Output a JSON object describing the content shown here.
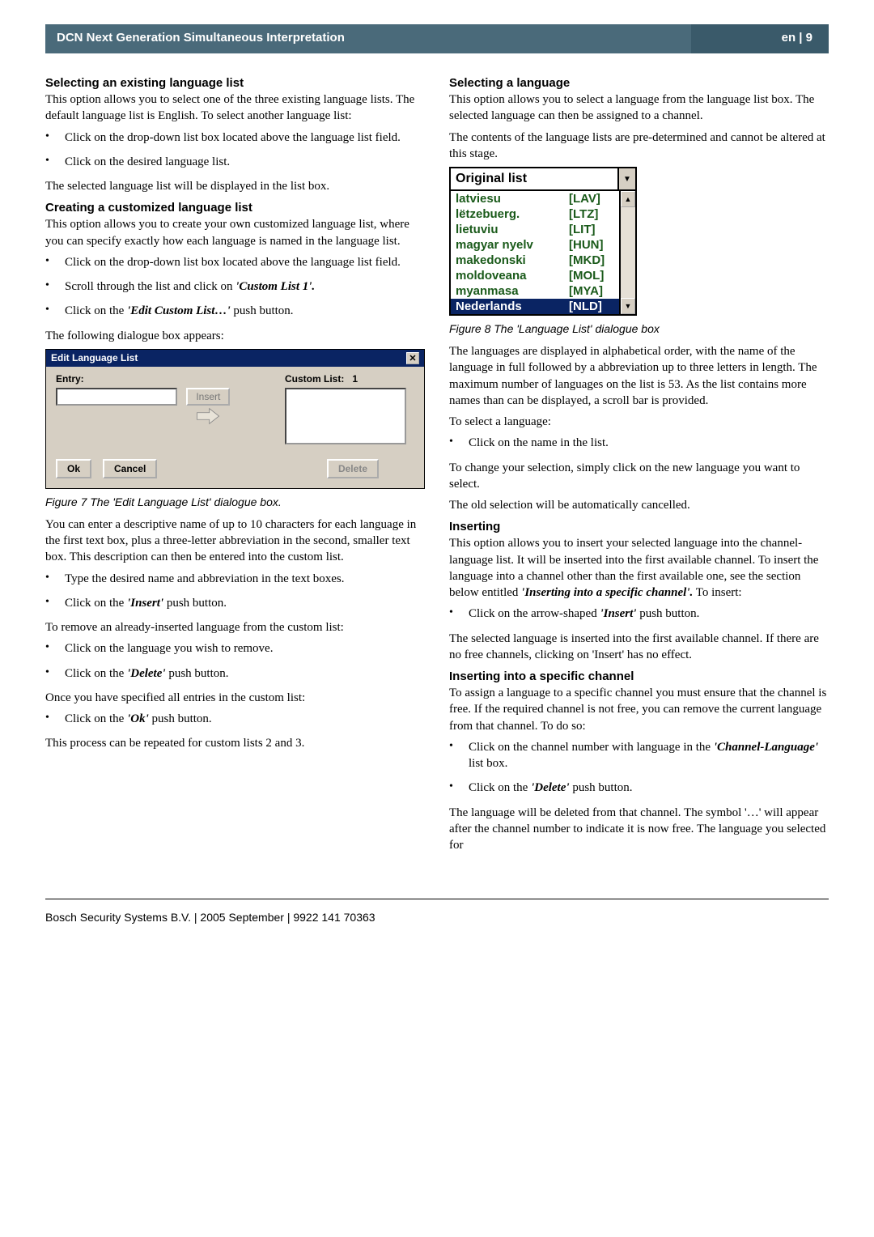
{
  "header": {
    "title": "DCN Next Generation Simultaneous Interpretation",
    "page": "en | 9"
  },
  "left": {
    "h1": "Selecting an existing language list",
    "p1": "This option allows you to select one of the three existing language lists. The default language list is English. To select another language list:",
    "b1": "Click on the drop-down list box located above the language list field.",
    "b2": "Click on the desired language list.",
    "p2": "The selected language list will be displayed in the list box.",
    "h2": "Creating a customized language list",
    "p3": "This option allows you to create your own customized language list, where you can specify exactly how each language is named in the language list.",
    "b3": "Click on the drop-down list box located above the language list field.",
    "b4a": "Scroll through the list and click on ",
    "b4b": "'Custom List 1'.",
    "b5a": "Click on the ",
    "b5b": "'Edit Custom List…'",
    "b5c": " push button.",
    "p4": "The following dialogue box appears:",
    "dlg": {
      "title": "Edit Language List",
      "entry": "Entry:",
      "insert": "Insert",
      "customlist": "Custom List:",
      "customnum": "1",
      "ok": "Ok",
      "cancel": "Cancel",
      "delete": "Delete"
    },
    "fig7": "Figure 7 The 'Edit Language List' dialogue box.",
    "p5": "You can enter a descriptive name of up to 10 characters for each language in the first text box, plus a three-letter abbreviation in the second, smaller text box. This description can then be entered into the custom list.",
    "b6": "Type the desired name and abbreviation in the text boxes.",
    "b7a": "Click on the ",
    "b7b": "'Insert'",
    "b7c": " push button.",
    "p6": "To remove an already-inserted language from the custom list:",
    "b8": "Click on the language you wish to remove.",
    "b9a": "Click on the ",
    "b9b": "'Delete'",
    "b9c": " push button.",
    "p7": "Once you have specified all entries in the custom list:",
    "b10a": "Click on the ",
    "b10b": "'Ok'",
    "b10c": " push button.",
    "p8": "This process can be repeated for custom lists 2 and 3."
  },
  "right": {
    "h1": "Selecting a language",
    "p1": "This option allows you to select a language from the language list box. The selected language can then be assigned to a channel.",
    "p2": "The contents of the language lists are pre-determined and cannot be altered at this stage.",
    "dd": {
      "selected": "Original list",
      "items": [
        {
          "name": "latviesu",
          "code": "[LAV]"
        },
        {
          "name": "lëtzebuerg.",
          "code": "[LTZ]"
        },
        {
          "name": "lietuviu",
          "code": "[LIT]"
        },
        {
          "name": "magyar nyelv",
          "code": "[HUN]"
        },
        {
          "name": "makedonski",
          "code": "[MKD]"
        },
        {
          "name": "moldoveana",
          "code": "[MOL]"
        },
        {
          "name": "myanmasa",
          "code": "[MYA]"
        },
        {
          "name": "Nederlands",
          "code": "[NLD]"
        }
      ]
    },
    "fig8": "Figure 8 The 'Language List' dialogue box",
    "p3": "The languages are displayed in alphabetical order, with the name of the language in full followed by a abbreviation up to three letters in length. The maximum number of languages on the list is 53. As the list contains more names than can be displayed, a scroll bar is provided.",
    "p4": "To select a language:",
    "b1": "Click on the name in the list.",
    "p5": "To change your selection, simply click on the new language you want to select.",
    "p6": "The old selection will be automatically cancelled.",
    "h2": "Inserting",
    "p7a": "This option allows you to insert your selected language into the channel-language list. It will be inserted into the first available channel. To insert the language into a channel other than the first available one, see the section below entitled ",
    "p7b": "'Inserting into a specific channel'.",
    "p7c": " To insert:",
    "b2a": "Click on the arrow-shaped ",
    "b2b": "'Insert'",
    "b2c": " push button.",
    "p8": "The selected language is inserted into the first available channel. If there are no free channels, clicking on 'Insert' has no effect.",
    "h3": "Inserting into a specific channel",
    "p9": "To assign a language to a specific channel you must ensure that the channel is free. If the required channel is not free, you can remove the current language from that channel. To do so:",
    "b3a": "Click on the channel number with language in the ",
    "b3b": "'Channel-Language'",
    "b3c": " list box.",
    "b4a": "Click on the ",
    "b4b": "'Delete'",
    "b4c": " push button.",
    "p10": "The language will be deleted from that channel. The symbol '…' will appear after the channel number to indicate it is now free. The language you selected for"
  },
  "footer": "Bosch Security Systems B.V. | 2005 September | 9922 141 70363"
}
